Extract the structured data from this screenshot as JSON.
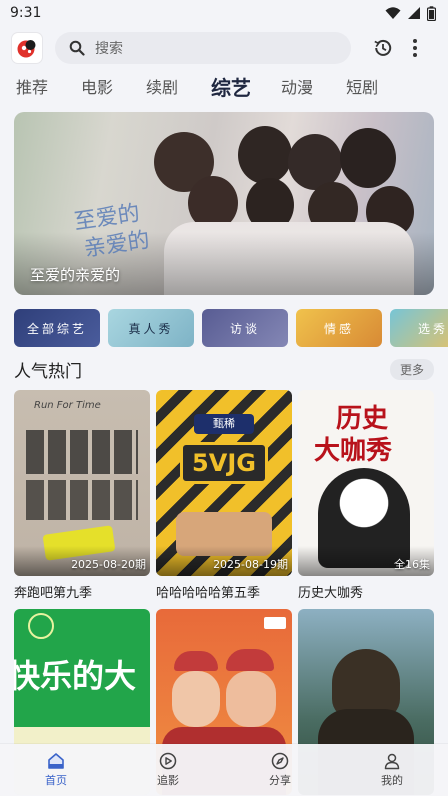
{
  "status_bar": {
    "time": "9:31"
  },
  "search": {
    "placeholder": "搜索"
  },
  "tabs": [
    {
      "label": "推荐"
    },
    {
      "label": "电影"
    },
    {
      "label": "续剧"
    },
    {
      "label": "综艺",
      "active": true
    },
    {
      "label": "动漫"
    },
    {
      "label": "短剧"
    }
  ],
  "banner": {
    "title": "至爱的亲爱的",
    "calligraphy_line1": "至爱的",
    "calligraphy_line2": "亲爱的"
  },
  "categories": [
    {
      "label": "全部综艺",
      "color": "#3a4c86"
    },
    {
      "label": "真人秀",
      "color": "#8fbfcf"
    },
    {
      "label": "访谈",
      "color": "#6c6fa2"
    },
    {
      "label": "情感",
      "color": "#e2a041"
    },
    {
      "label": "选秀",
      "color": "#4fb2c8"
    }
  ],
  "section": {
    "title": "人气热门",
    "more": "更多"
  },
  "cards": [
    {
      "title": "奔跑吧第九季",
      "badge": "2025-08-20期"
    },
    {
      "title": "哈哈哈哈哈第五季",
      "badge": "2025-08-19期"
    },
    {
      "title": "历史大咖秀",
      "badge": "全16集"
    },
    {
      "title": "",
      "badge": ""
    },
    {
      "title": "",
      "badge": ""
    },
    {
      "title": "",
      "badge": ""
    }
  ],
  "posters": {
    "p1_text": "Run For Time",
    "p2_brand": "甄稀",
    "p2_logo": "5VJG",
    "p3_text1": "历史",
    "p3_text2": "大咖秀",
    "p4_text": "快乐的大"
  },
  "bottom_nav": [
    {
      "label": "首页",
      "active": true
    },
    {
      "label": "追影"
    },
    {
      "label": "分享"
    },
    {
      "label": "我的"
    }
  ],
  "colors": {
    "accent": "#3a63c9",
    "background": "#f3f4f8"
  }
}
